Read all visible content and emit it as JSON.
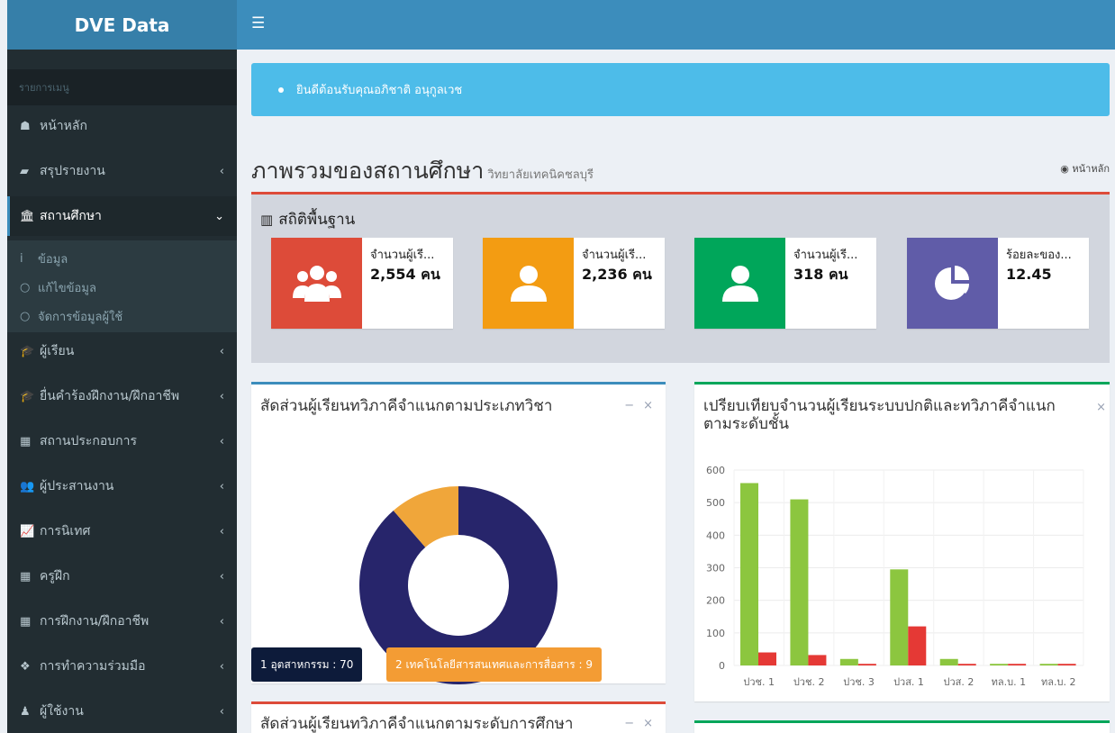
{
  "app": {
    "brand": "DVE Data"
  },
  "sidebar": {
    "header": "รายการเมนู",
    "items": [
      {
        "label": "หน้าหลัก",
        "icon": "home-icon",
        "glyph": "☗",
        "has_chevron": false
      },
      {
        "label": "สรุปรายงาน",
        "icon": "book-icon",
        "glyph": "▰",
        "has_chevron": true
      },
      {
        "label": "สถานศึกษา",
        "icon": "bank-icon",
        "glyph": "🏛",
        "has_chevron": true,
        "active": true
      },
      {
        "label": "ผู้เรียน",
        "icon": "graduation-cap-icon",
        "glyph": "🎓",
        "has_chevron": true
      },
      {
        "label": "ยื่นคำร้องฝึกงาน/ฝึกอาชีพ",
        "icon": "graduation-cap-icon",
        "glyph": "🎓",
        "has_chevron": true
      },
      {
        "label": "สถานประกอบการ",
        "icon": "building-icon",
        "glyph": "▦",
        "has_chevron": true
      },
      {
        "label": "ผู้ประสานงาน",
        "icon": "users-icon",
        "glyph": "👥",
        "has_chevron": true
      },
      {
        "label": "การนิเทศ",
        "icon": "line-chart-icon",
        "glyph": "📈",
        "has_chevron": true
      },
      {
        "label": "ครูฝึก",
        "icon": "building-icon",
        "glyph": "▦",
        "has_chevron": true
      },
      {
        "label": "การฝึกงาน/ฝึกอาชีพ",
        "icon": "building-icon",
        "glyph": "▦",
        "has_chevron": true
      },
      {
        "label": "การทำความร่วมมือ",
        "icon": "cubes-icon",
        "glyph": "❖",
        "has_chevron": true
      },
      {
        "label": "ผู้ใช้งาน",
        "icon": "user-icon",
        "glyph": "♟",
        "has_chevron": true
      }
    ],
    "subitems": [
      {
        "label": "ข้อมูล",
        "icon": "info-icon",
        "glyph": "i"
      },
      {
        "label": "แก้ไขข้อมูล",
        "icon": "circle-icon",
        "glyph": "○"
      },
      {
        "label": "จัดการข้อมูลผู้ใช้",
        "icon": "circle-icon",
        "glyph": "○"
      }
    ]
  },
  "alert": {
    "message": "ยินดีต้อนรับคุณอภิชาติ อนุกูลเวช"
  },
  "page": {
    "title": "ภาพรวมของสถานศึกษา",
    "subtitle": "วิทยาลัยเทคนิคชลบุรี",
    "breadcrumb": "หน้าหลัก"
  },
  "stats": {
    "title": "สถิติพื้นฐาน",
    "boxes": [
      {
        "label": "จำนวนผู้เรี...",
        "value": "2,554 คน",
        "color": "#dd4b39",
        "icon": "users-icon"
      },
      {
        "label": "จำนวนผู้เรี...",
        "value": "2,236 คน",
        "color": "#f39c12",
        "icon": "user-icon"
      },
      {
        "label": "จำนวนผู้เรี...",
        "value": "318 คน",
        "color": "#00a65a",
        "icon": "user-icon"
      },
      {
        "label": "ร้อยละของ...",
        "value": "12.45",
        "color": "#605ca8",
        "icon": "pie-chart-icon"
      }
    ]
  },
  "donut_card": {
    "title": "สัดส่วนผู้เรียนทวิภาคีจำแนกตามประเภทวิชา",
    "badges": [
      {
        "label": "1 อุตสาหกรรม : 70",
        "color": "#0d1b3a"
      },
      {
        "label": "2 เทคโนโลยีสารสนเทศและการสื่อสาร : 9",
        "color": "#f39c34"
      }
    ]
  },
  "bar_card": {
    "title_line1": "เปรียบเทียบจำนวนผู้เรียนระบบปกติและทวิภาคีจำแนก",
    "title_line2": "ตามระดับชั้น"
  },
  "bottom_card": {
    "title": "สัดส่วนผู้เรียนทวิภาคีจำแนกตามระดับการศึกษา"
  },
  "tools": {
    "minimize": "−",
    "close": "×"
  },
  "chart_data": [
    {
      "type": "pie",
      "categories": [
        "อุตสาหกรรม",
        "เทคโนโลยีสารสนเทศและการสื่อสาร"
      ],
      "values": [
        70,
        9
      ],
      "colors": [
        "#27256b",
        "#f0a63a"
      ]
    },
    {
      "type": "bar",
      "categories": [
        "ปวช. 1",
        "ปวช. 2",
        "ปวช. 3",
        "ปวส. 1",
        "ปวส. 2",
        "ทล.บ. 1",
        "ทล.บ. 2"
      ],
      "series": [
        {
          "values": [
            560,
            510,
            20,
            295,
            20,
            5,
            5
          ],
          "color": "#8cc63f"
        },
        {
          "values": [
            40,
            32,
            5,
            120,
            5,
            5,
            5
          ],
          "color": "#e53935"
        }
      ],
      "ylim": [
        0,
        600
      ],
      "yticks": [
        0,
        100,
        200,
        300,
        400,
        500,
        600
      ],
      "grid": true
    }
  ]
}
